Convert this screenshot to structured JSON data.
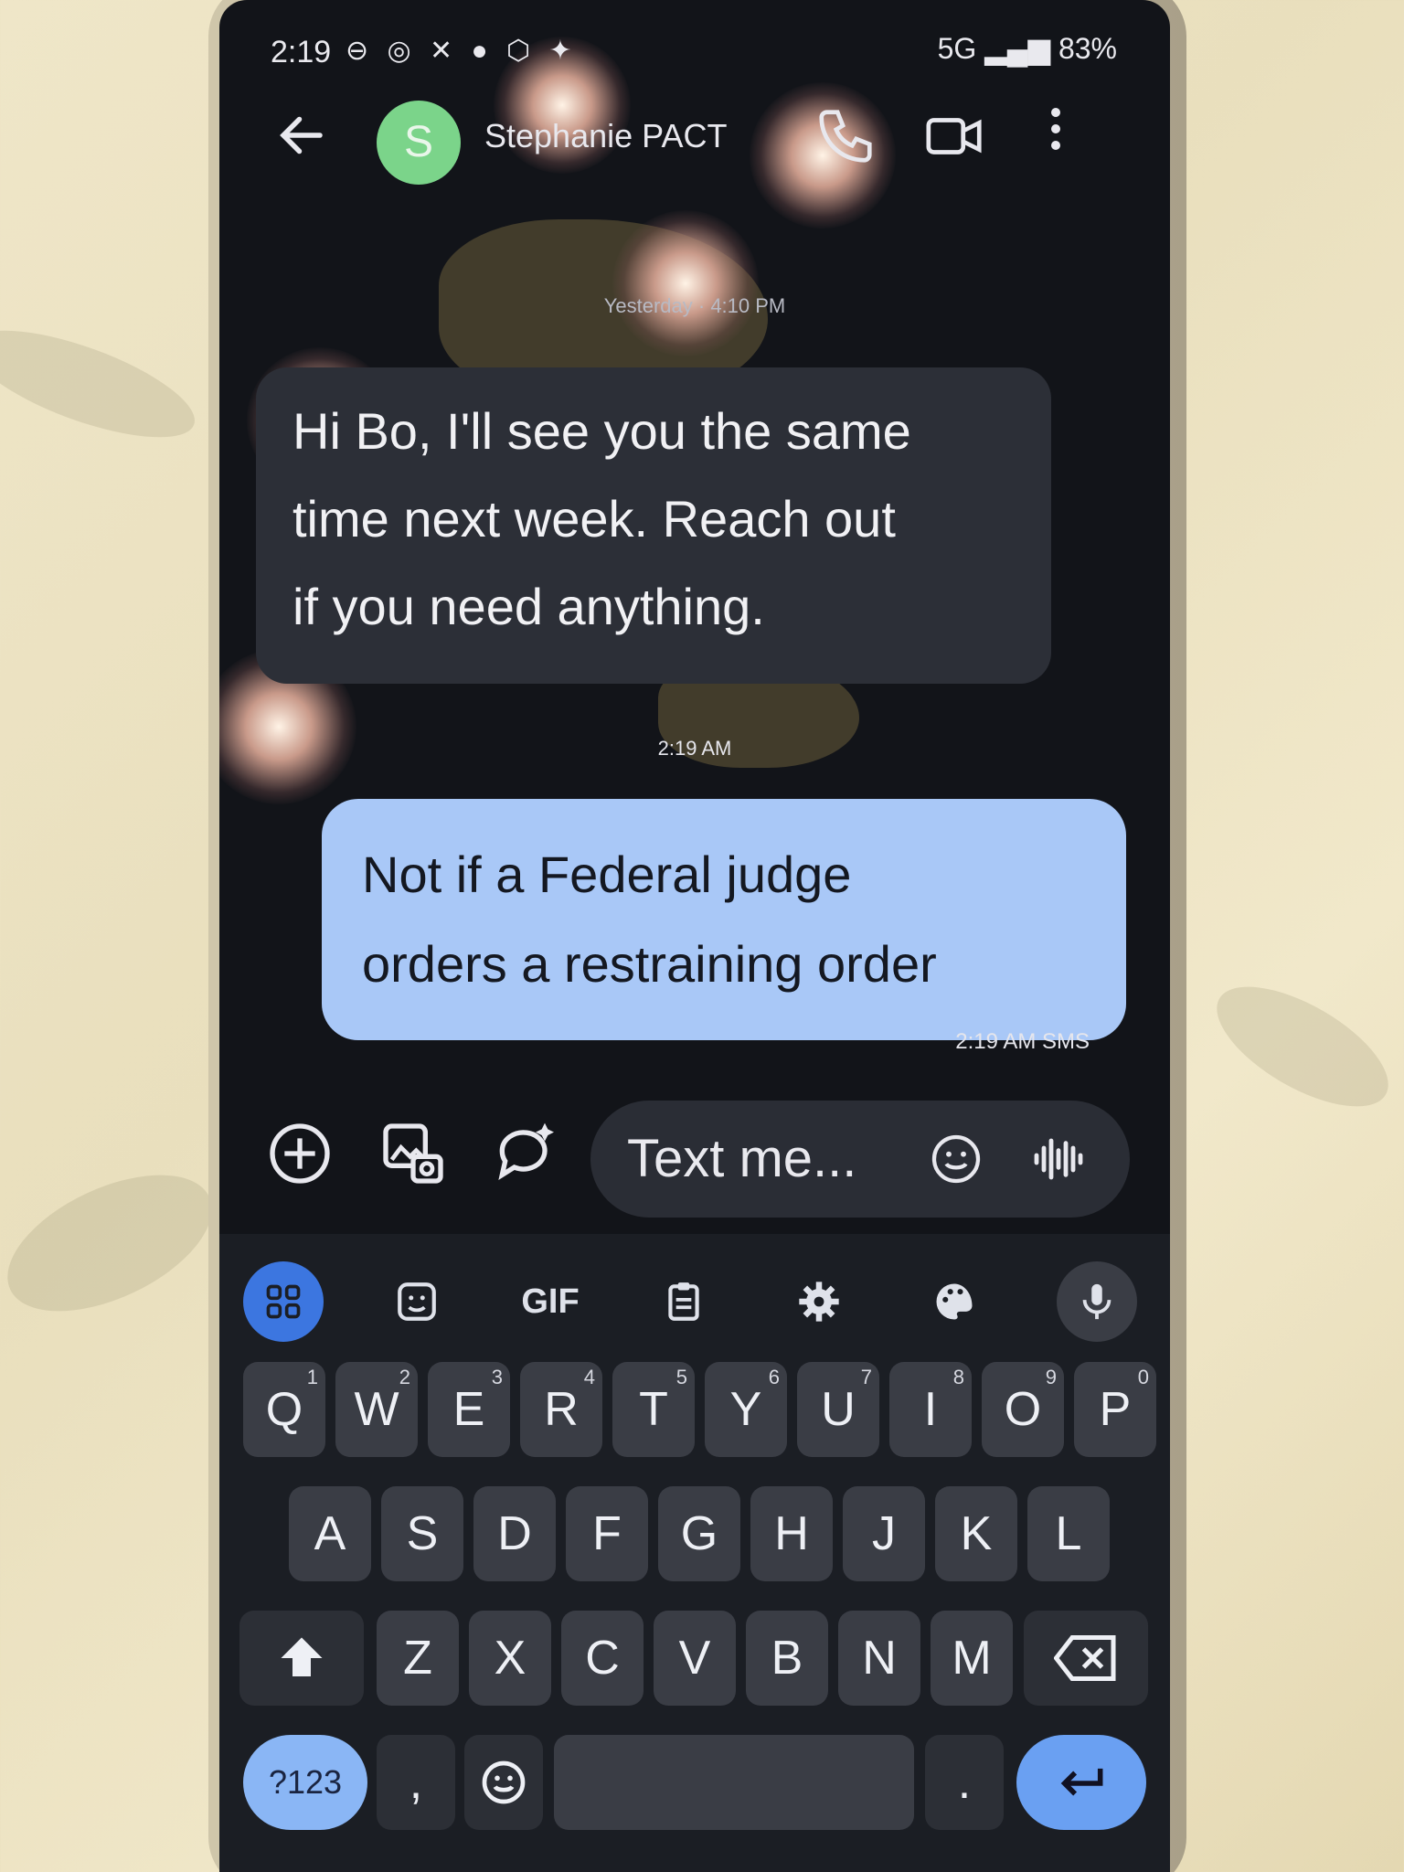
{
  "status_bar": {
    "time": "2:19",
    "icons": "⊖ ◎ ✕ ● ⬡ ✦",
    "right": "5G ▂▄▆ 83%"
  },
  "header": {
    "back_icon": "arrow-left-icon",
    "avatar_letter": "S",
    "avatar_color": "#7bd48a",
    "contact_name": "Stephanie PACT"
  },
  "conversation": {
    "timestamp_1": "Yesterday · 4:10 PM",
    "incoming_lines": [
      "Hi Bo, I'll see you the same",
      "time next week. Reach out",
      "if you need anything."
    ],
    "timestamp_2": "2:19 AM",
    "outgoing_lines": [
      "Not if a Federal judge",
      "orders a restraining order"
    ],
    "outgoing_meta": "2:19 AM  SMS"
  },
  "compose": {
    "placeholder": "Text me..."
  },
  "keyboard": {
    "toolbar_gif": "GIF",
    "row1": [
      {
        "k": "Q",
        "n": "1"
      },
      {
        "k": "W",
        "n": "2"
      },
      {
        "k": "E",
        "n": "3"
      },
      {
        "k": "R",
        "n": "4"
      },
      {
        "k": "T",
        "n": "5"
      },
      {
        "k": "Y",
        "n": "6"
      },
      {
        "k": "U",
        "n": "7"
      },
      {
        "k": "I",
        "n": "8"
      },
      {
        "k": "O",
        "n": "9"
      },
      {
        "k": "P",
        "n": "0"
      }
    ],
    "row2": [
      "A",
      "S",
      "D",
      "F",
      "G",
      "H",
      "J",
      "K",
      "L"
    ],
    "row3": [
      "Z",
      "X",
      "C",
      "V",
      "B",
      "N",
      "M"
    ],
    "symbols_label": "?123",
    "comma_label": ",",
    "period_label": "."
  },
  "colors": {
    "accent": "#3c76e0",
    "outgoing_bubble": "#a9c8f7",
    "incoming_bubble": "#2c2f37"
  }
}
